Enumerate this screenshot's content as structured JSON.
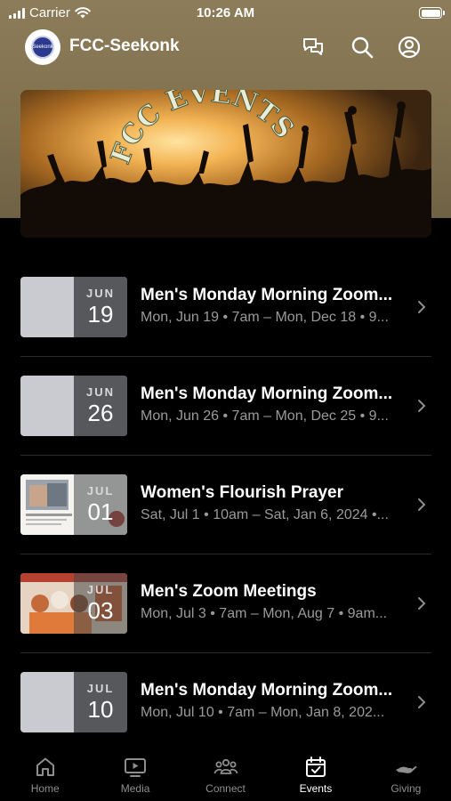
{
  "status_bar": {
    "carrier": "Carrier",
    "time": "10:26 AM"
  },
  "header": {
    "title": "FCC-Seekonk",
    "logo_text": "Seekonk"
  },
  "banner": {
    "text": "FCC EVENTS"
  },
  "events": [
    {
      "month": "JUN",
      "day": "19",
      "title": "Men's Monday Morning Zoom...",
      "subtitle": "Mon, Jun 19 • 7am – Mon, Dec 18 • 9...",
      "thumb": "blank"
    },
    {
      "month": "JUN",
      "day": "26",
      "title": "Men's Monday Morning Zoom...",
      "subtitle": "Mon, Jun 26 • 7am – Mon, Dec 25 • 9...",
      "thumb": "blank"
    },
    {
      "month": "JUL",
      "day": "01",
      "title": "Women's Flourish Prayer",
      "subtitle": "Sat, Jul 1 • 10am – Sat, Jan 6, 2024 •...",
      "thumb": "flourish"
    },
    {
      "month": "JUL",
      "day": "03",
      "title": "Men's Zoom Meetings",
      "subtitle": "Mon, Jul 3 • 7am – Mon, Aug 7 • 9am...",
      "thumb": "mens-zoom"
    },
    {
      "month": "JUL",
      "day": "10",
      "title": "Men's Monday Morning Zoom...",
      "subtitle": "Mon, Jul 10 • 7am – Mon, Jan 8, 202...",
      "thumb": "blank"
    }
  ],
  "tabs": [
    {
      "label": "Home",
      "icon": "home-icon",
      "active": false
    },
    {
      "label": "Media",
      "icon": "media-icon",
      "active": false
    },
    {
      "label": "Connect",
      "icon": "connect-icon",
      "active": false
    },
    {
      "label": "Events",
      "icon": "events-icon",
      "active": true
    },
    {
      "label": "Giving",
      "icon": "giving-icon",
      "active": false
    }
  ],
  "colors": {
    "header_bg": "#8c7c5a",
    "background": "#000000",
    "subtitle": "#9a9a9a",
    "tab_inactive": "#8e8e8e"
  }
}
